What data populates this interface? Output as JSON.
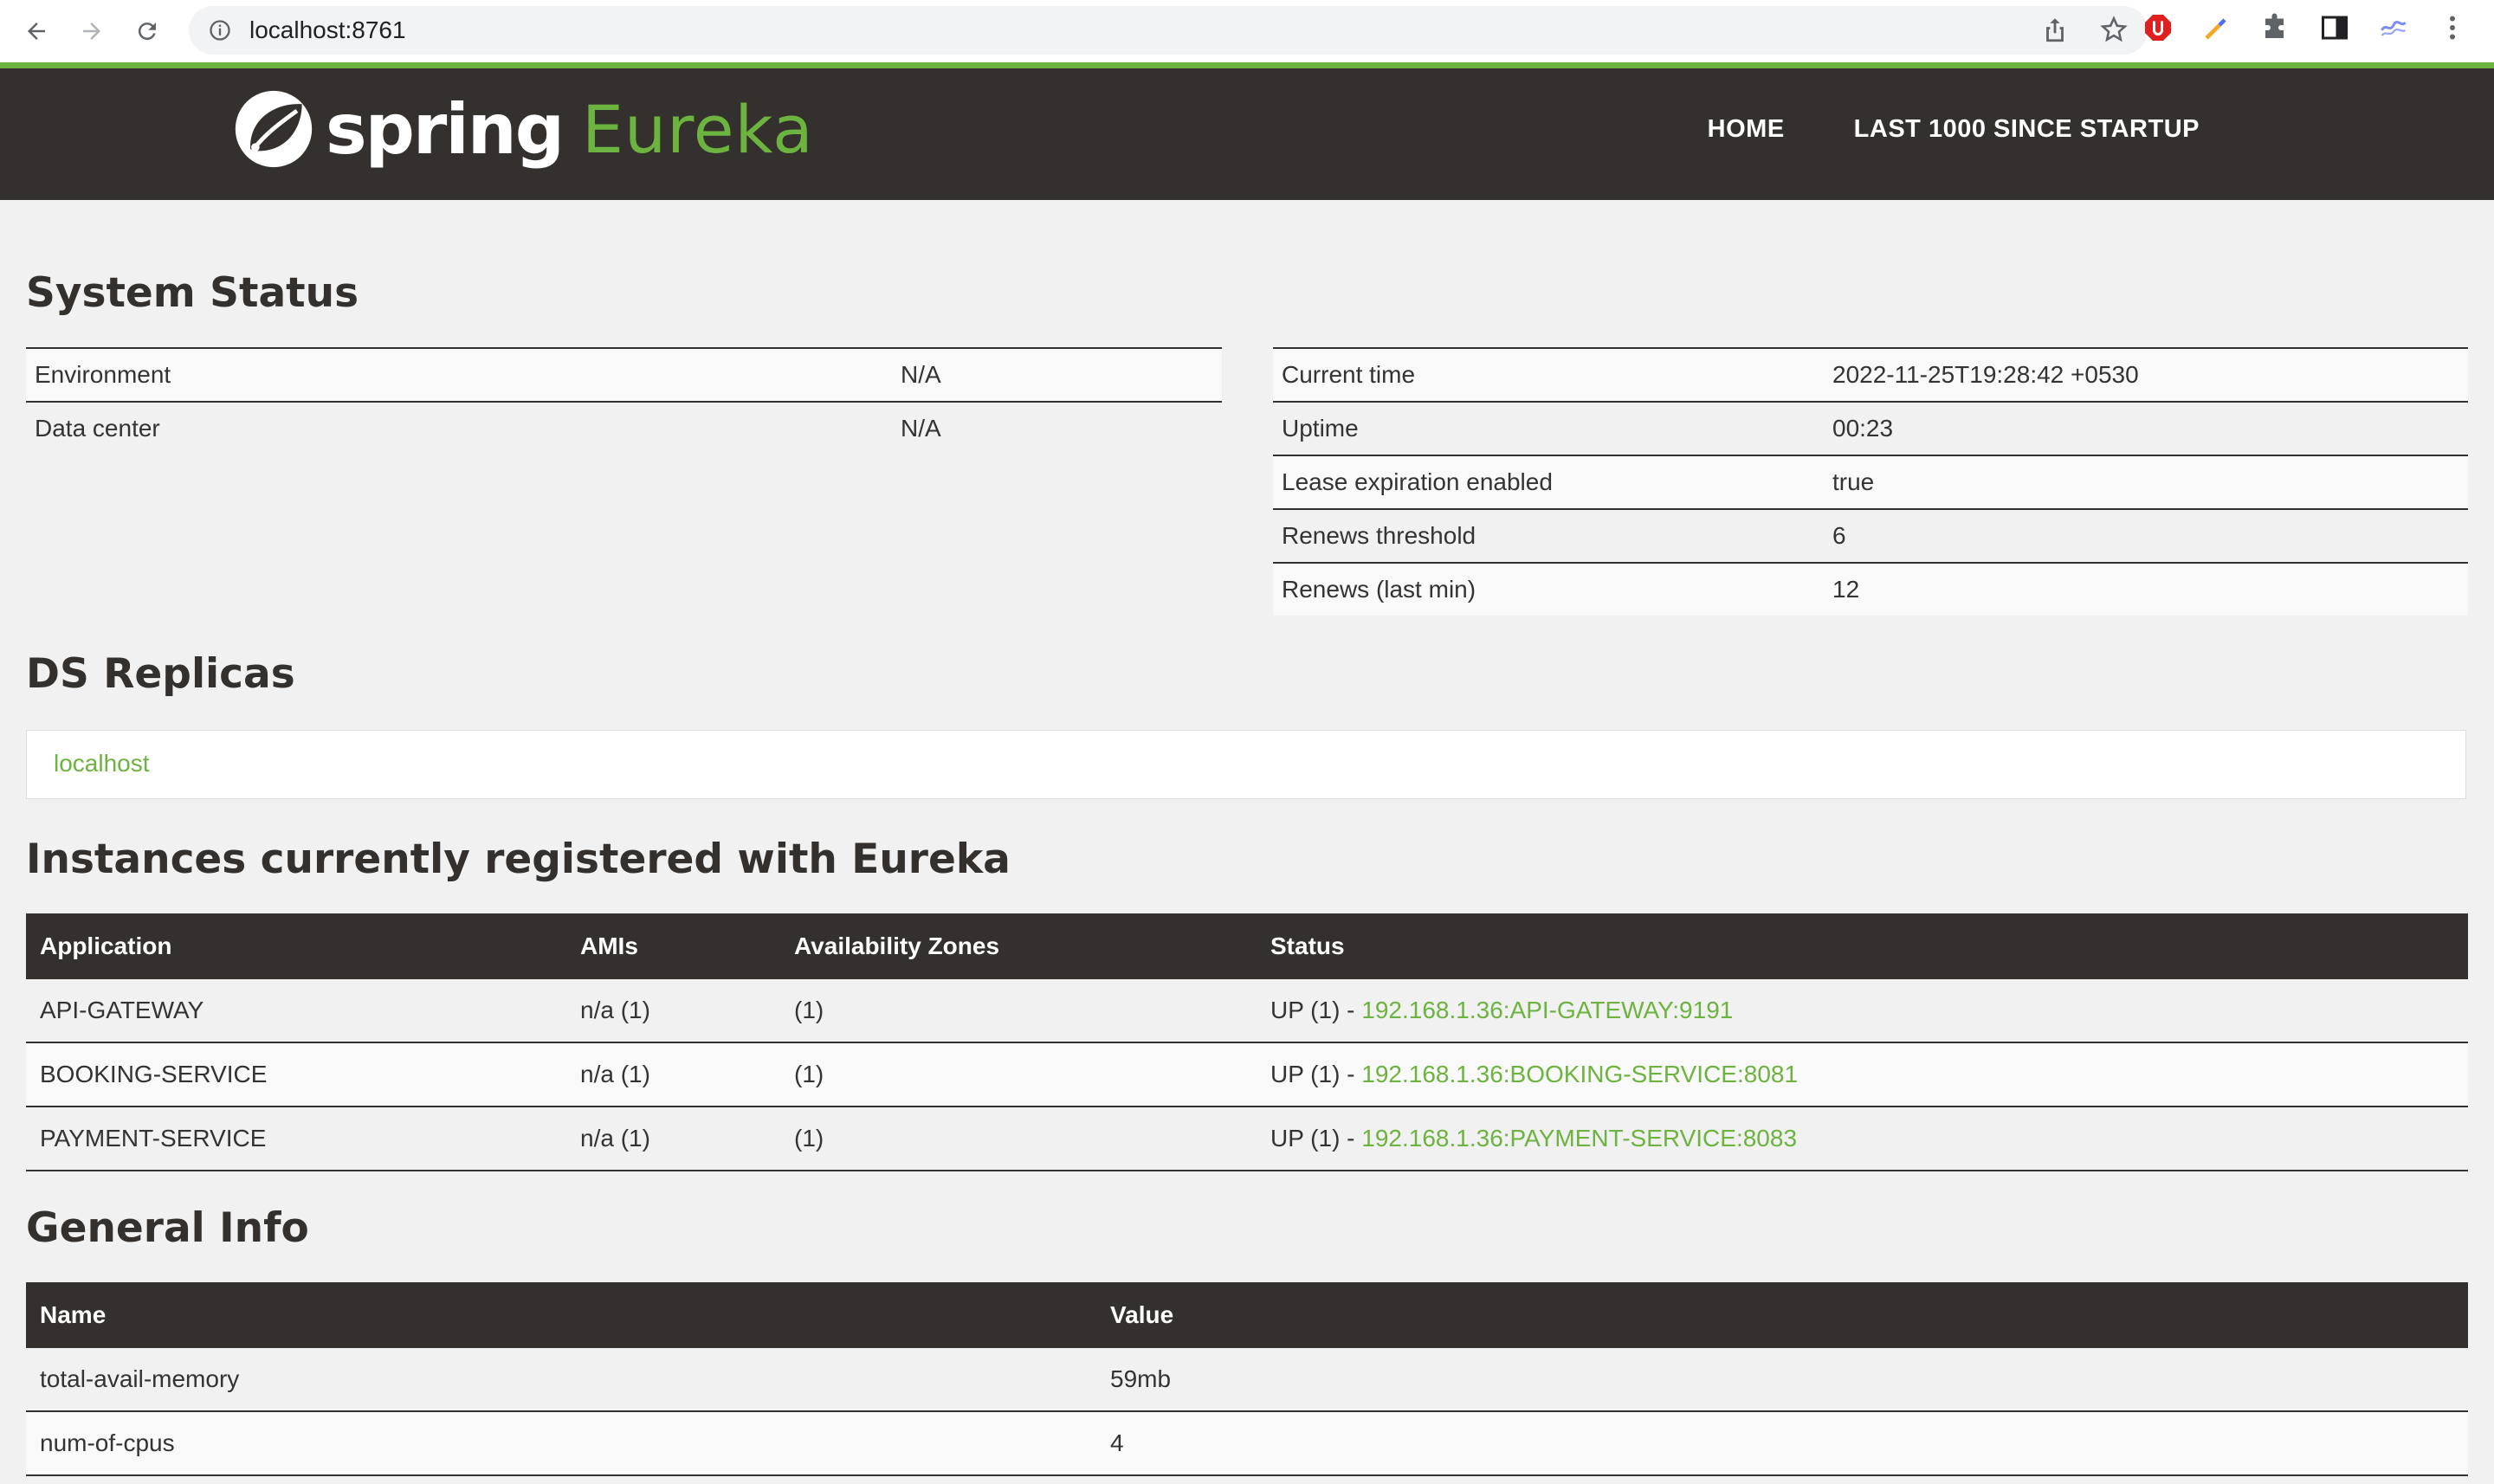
{
  "browser": {
    "url": "localhost:8761"
  },
  "header": {
    "logo_spring": "spring",
    "logo_eureka": "Eureka",
    "nav": [
      "HOME",
      "LAST 1000 SINCE STARTUP"
    ]
  },
  "system_status": {
    "title": "System Status",
    "left": [
      {
        "label": "Environment",
        "value": "N/A"
      },
      {
        "label": "Data center",
        "value": "N/A"
      }
    ],
    "right": [
      {
        "label": "Current time",
        "value": "2022-11-25T19:28:42 +0530"
      },
      {
        "label": "Uptime",
        "value": "00:23"
      },
      {
        "label": "Lease expiration enabled",
        "value": "true"
      },
      {
        "label": "Renews threshold",
        "value": "6"
      },
      {
        "label": "Renews (last min)",
        "value": "12"
      }
    ]
  },
  "ds_replicas": {
    "title": "DS Replicas",
    "items": [
      "localhost"
    ]
  },
  "instances": {
    "title": "Instances currently registered with Eureka",
    "columns": [
      "Application",
      "AMIs",
      "Availability Zones",
      "Status"
    ],
    "rows": [
      {
        "application": "API-GATEWAY",
        "amis": "n/a (1)",
        "zones": "(1)",
        "status_prefix": "UP (1) - ",
        "status_link": "192.168.1.36:API-GATEWAY:9191"
      },
      {
        "application": "BOOKING-SERVICE",
        "amis": "n/a (1)",
        "zones": "(1)",
        "status_prefix": "UP (1) - ",
        "status_link": "192.168.1.36:BOOKING-SERVICE:8081"
      },
      {
        "application": "PAYMENT-SERVICE",
        "amis": "n/a (1)",
        "zones": "(1)",
        "status_prefix": "UP (1) - ",
        "status_link": "192.168.1.36:PAYMENT-SERVICE:8083"
      }
    ]
  },
  "general_info": {
    "title": "General Info",
    "columns": [
      "Name",
      "Value"
    ],
    "rows": [
      {
        "name": "total-avail-memory",
        "value": "59mb"
      },
      {
        "name": "num-of-cpus",
        "value": "4"
      }
    ]
  },
  "colors": {
    "accent": "#6db33f",
    "header_bg": "#34302d",
    "page_bg": "#f1f1f1"
  }
}
